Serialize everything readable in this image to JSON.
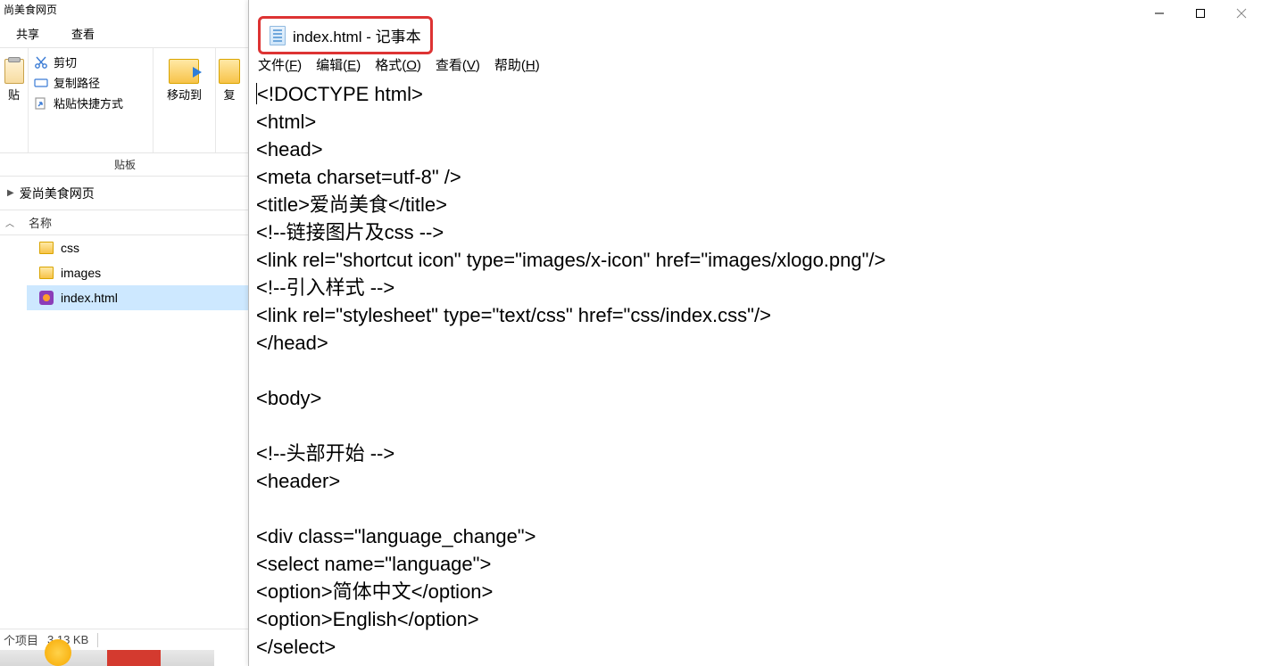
{
  "explorer": {
    "title_partial": "尚美食网页",
    "tabs": {
      "share": "共享",
      "view": "查看"
    },
    "ribbon": {
      "cut": "剪切",
      "copy_path": "复制路径",
      "paste_shortcut": "粘贴快捷方式",
      "paste_label": "贴",
      "clipboard_group": "贴板",
      "move_to": "移动到",
      "copy_partial": "复"
    },
    "breadcrumb": "爱尚美食网页",
    "column_name": "名称",
    "files": {
      "css": "css",
      "images": "images",
      "index": "index.html"
    },
    "status": {
      "items": "个项目",
      "size": "3.13 KB"
    }
  },
  "notepad": {
    "title": "index.html - 记事本",
    "menu": {
      "file": "文件(F)",
      "edit": "编辑(E)",
      "format": "格式(O)",
      "view": "查看(V)",
      "help": "帮助(H)"
    },
    "lines": [
      "<!DOCTYPE html>",
      "<html>",
      "<head>",
      "<meta charset=utf-8\" />",
      "<title>爱尚美食</title>",
      "<!--链接图片及css -->",
      "<link rel=\"shortcut icon\" type=\"images/x-icon\" href=\"images/xlogo.png\"/>",
      "<!--引入样式 -->",
      "<link rel=\"stylesheet\" type=\"text/css\" href=\"css/index.css\"/>",
      "</head>",
      "",
      "<body>",
      "",
      "<!--头部开始 -->",
      "<header>",
      "",
      "<div class=\"language_change\">",
      "<select name=\"language\">",
      "<option>简体中文</option>",
      "<option>English</option>",
      "</select>"
    ]
  }
}
